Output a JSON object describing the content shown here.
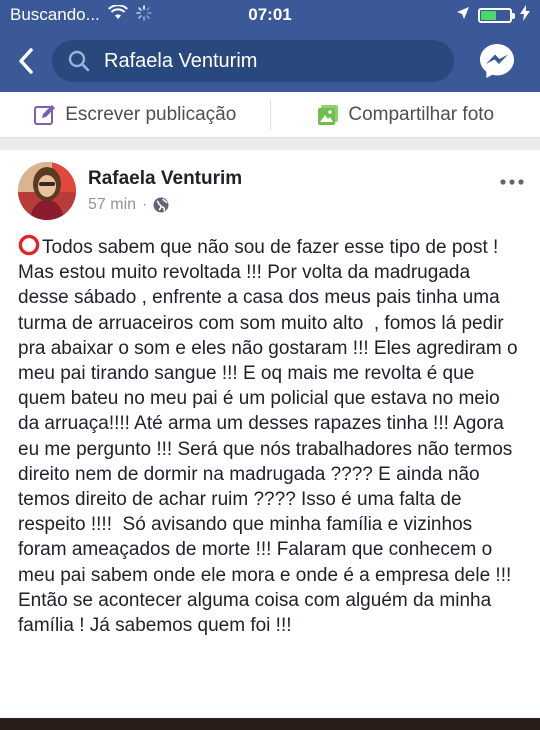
{
  "status_bar": {
    "carrier": "Buscando...",
    "time": "07:01",
    "battery_level": 0.55,
    "battery_color": "#4cd964"
  },
  "nav": {
    "back_icon": "chevron-left-icon",
    "search_icon": "search-icon",
    "search_value": "Rafaela Venturim",
    "messenger_icon": "messenger-icon"
  },
  "composer": {
    "write_label": "Escrever publicação",
    "write_icon": "edit-icon",
    "photo_label": "Compartilhar foto",
    "photo_icon": "photo-icon",
    "photo_icon_color": "#6bbf4a"
  },
  "post": {
    "author": "Rafaela Venturim",
    "time": "57 min",
    "separator": "·",
    "privacy_icon": "globe-icon",
    "more_icon": "more-icon",
    "lead_icon": "red-circle-icon",
    "body": "Todos sabem que não sou de fazer esse tipo de post ! Mas estou muito revoltada !!! Por volta da madrugada desse sábado , enfrente a casa dos meus pais tinha uma turma de arruaceiros com som muito alto  , fomos lá pedir pra abaixar o som e eles não gostaram !!! Eles agrediram o meu pai tirando sangue !!! E oq mais me revolta é que quem bateu no meu pai é um policial que estava no meio da arruaça!!!! Até arma um desses rapazes tinha !!! Agora eu me pergunto !!! Será que nós trabalhadores não termos direito nem de dormir na madrugada ???? E ainda não temos direito de achar ruim ???? Isso é uma falta de respeito !!!!  Só avisando que minha família e vizinhos foram ameaçados de morte !!! Falaram que conhecem o meu pai sabem onde ele mora e onde é a empresa dele !!! Então se acontecer alguma coisa com alguém da minha família ! Já sabemos quem foi !!!"
  },
  "colors": {
    "brand": "#3b5998",
    "search_bg": "#29487d",
    "meta_text": "#90949c"
  }
}
